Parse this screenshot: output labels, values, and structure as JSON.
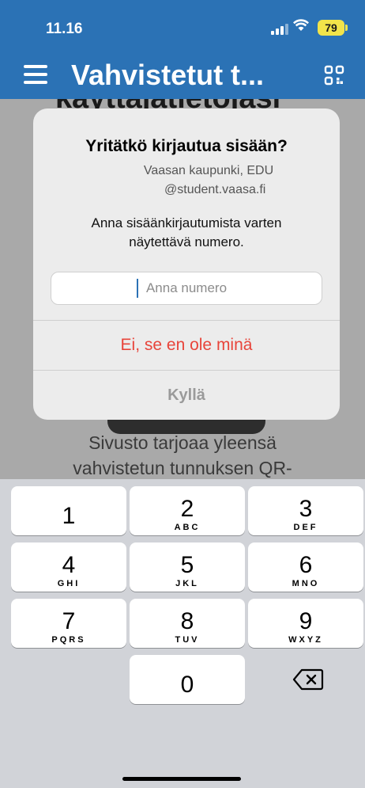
{
  "status": {
    "time": "11.16",
    "battery": "79"
  },
  "header": {
    "title": "Vahvistetut t..."
  },
  "background": {
    "heading_fragment": "käyttäjätietojasi",
    "paragraph_line1": "Sivusto tarjoaa yleensä",
    "paragraph_line2": "vahvistetun tunnuksen QR-"
  },
  "dialog": {
    "title": "Yritätkö kirjautua sisään?",
    "organization": "Vaasan kaupunki, EDU",
    "account": "@student.vaasa.fi",
    "message": "Anna sisäänkirjautumista varten näytettävä numero.",
    "input_placeholder": "Anna numero",
    "deny_label": "Ei, se en ole minä",
    "confirm_label": "Kyllä"
  },
  "keypad": {
    "keys": [
      {
        "digit": "1",
        "letters": ""
      },
      {
        "digit": "2",
        "letters": "ABC"
      },
      {
        "digit": "3",
        "letters": "DEF"
      },
      {
        "digit": "4",
        "letters": "GHI"
      },
      {
        "digit": "5",
        "letters": "JKL"
      },
      {
        "digit": "6",
        "letters": "MNO"
      },
      {
        "digit": "7",
        "letters": "PQRS"
      },
      {
        "digit": "8",
        "letters": "TUV"
      },
      {
        "digit": "9",
        "letters": "WXYZ"
      },
      {
        "digit": "0",
        "letters": ""
      }
    ],
    "backspace_icon": "delete-left-icon"
  },
  "colors": {
    "header_blue": "#2b72b5",
    "deny_red": "#e8443a",
    "battery_yellow": "#f2e44a"
  }
}
